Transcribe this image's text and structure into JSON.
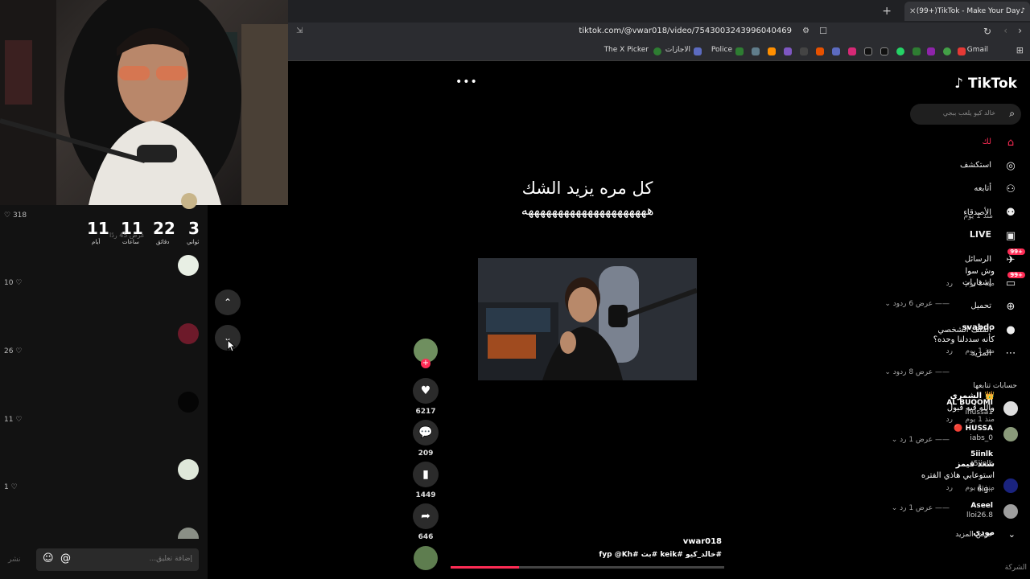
{
  "browser": {
    "tab_title": "(99+)TikTok - Make Your Day",
    "url": "tiktok.com/@vwar018/video/7543003243996040469",
    "bookmarks": [
      "Gmail",
      "Police",
      "الاجازات",
      "The X Picker"
    ]
  },
  "countdown": {
    "units": [
      {
        "value": "3",
        "label": "ثواني"
      },
      {
        "value": "22",
        "label": "دقائق"
      },
      {
        "value": "11",
        "label": "ساعات"
      },
      {
        "value": "11",
        "label": "أيام"
      }
    ],
    "replies_overlay": "عرض 45 ردًا"
  },
  "comments": [
    {
      "user": "",
      "text": "وش سوا",
      "time": "منذ 1 يوم",
      "reply": "رد",
      "likes": "10",
      "replies": "عرض 6 ردود",
      "avatar_color": "#e8efe4"
    },
    {
      "user": "svabdo",
      "text": "كأنه سددلنا وحده؟",
      "time": "منذ 1 يوم",
      "reply": "رد",
      "likes": "26",
      "replies": "عرض 8 ردود",
      "avatar_color": "#6d1a2a"
    },
    {
      "user": "الشمري",
      "text": "والله فيه قبول",
      "time": "منذ 1 يوم",
      "reply": "رد",
      "likes": "11",
      "replies": "عرض 1 رد",
      "avatar_color": "#050505"
    },
    {
      "user": "سعد قيمز",
      "text": "استوعابي هاذي الفتره",
      "time": "منذ 1 يوم",
      "reply": "رد",
      "likes": "1",
      "replies": "عرض 1 رد",
      "avatar_color": "#dfe8da"
    },
    {
      "user": "مودي",
      "text": "",
      "time": "",
      "reply": "",
      "likes": "",
      "replies": "",
      "avatar_color": "#8a8f86"
    }
  ],
  "top_comment_likes": "318",
  "comment_input": {
    "placeholder": "إضافة تعليق...",
    "post": "نشر"
  },
  "video": {
    "caption_line1": "كل مره يزيد الشك",
    "caption_line2": "هههههههههههههههههههههه",
    "author": "vwar018",
    "hashtags": "#خالد_كيو #keik #بث #fyp @Kh",
    "progress": 0.25
  },
  "actions": {
    "likes": "6217",
    "comments": "209",
    "saves": "1449",
    "shares": "646"
  },
  "sidebar": {
    "logo": "TikTok",
    "search_placeholder": "خالد كيو يلعب ببجي",
    "nav": [
      {
        "label": "لك",
        "icon": "home-icon",
        "active": true
      },
      {
        "label": "استكشف",
        "icon": "compass-icon"
      },
      {
        "label": "أتابعه",
        "icon": "user-follow-icon"
      },
      {
        "label": "الأصدقاء",
        "icon": "friends-icon"
      },
      {
        "label": "LIVE",
        "icon": "live-icon"
      },
      {
        "label": "الرسائل",
        "icon": "messages-icon",
        "badge": "99+"
      },
      {
        "label": "إشعارات",
        "icon": "notifications-icon",
        "badge": "99+"
      },
      {
        "label": "تحميل",
        "icon": "upload-icon"
      },
      {
        "label": "الملف الشخصي",
        "icon": "profile-icon"
      },
      {
        "label": "المزيد",
        "icon": "more-icon"
      }
    ],
    "following_title": "حسابات تتابعها",
    "following": [
      {
        "name": "AL BUQOMI",
        "user": "ihussa1"
      },
      {
        "name": "HUSSA",
        "user": "iabs_0"
      },
      {
        "name": "5iinlk",
        "user": "5iinlk"
      },
      {
        "name": "",
        "user": "6ig.."
      },
      {
        "name": "Aseel",
        "user": "lloi26.8"
      }
    ],
    "see_more": "عرض المزيد",
    "company": "الشركة"
  },
  "colors": {
    "accent": "#fe2c55"
  }
}
